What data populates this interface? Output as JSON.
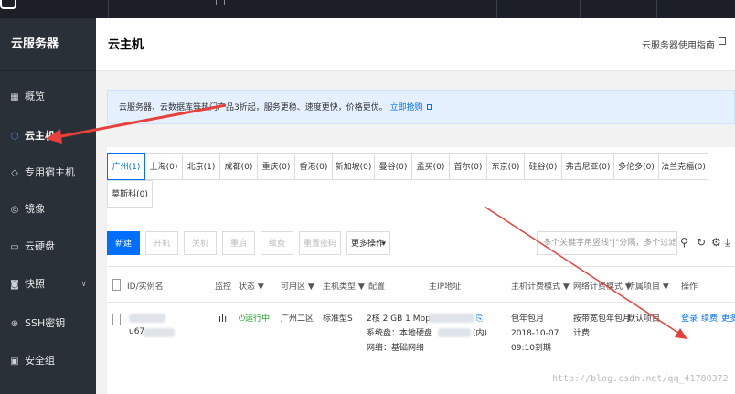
{
  "sidebar": {
    "title": "云服务器",
    "items": [
      {
        "label": "概览",
        "icon": "grid-icon"
      },
      {
        "label": "云主机",
        "icon": "cube-icon",
        "active": true
      },
      {
        "label": "专用宿主机",
        "icon": "diamond-icon"
      },
      {
        "label": "镜像",
        "icon": "disc-icon"
      },
      {
        "label": "云硬盘",
        "icon": "disk-icon"
      },
      {
        "label": "快照",
        "icon": "camera-icon",
        "has_chevron": true
      },
      {
        "label": "SSH密钥",
        "icon": "key-icon"
      },
      {
        "label": "安全组",
        "icon": "shield-icon"
      }
    ]
  },
  "header": {
    "title": "云主机",
    "guide_link": "云服务器使用指南"
  },
  "notice": {
    "text": "云服务器、云数据库等热门产品3折起，服务更稳、速度更快，价格更优。",
    "link": "立即抢购"
  },
  "regions": {
    "row1": [
      "广州(1)",
      "上海(0)",
      "北京(1)",
      "成都(0)",
      "重庆(0)",
      "香港(0)",
      "新加坡(0)",
      "曼谷(0)",
      "孟买(0)",
      "首尔(0)",
      "东京(0)",
      "硅谷(0)",
      "弗吉尼亚(0)",
      "多伦多(0)",
      "法兰克福(0)"
    ],
    "row2": [
      "莫斯科(0)"
    ]
  },
  "toolbar": {
    "buttons": [
      "新建",
      "开机",
      "关机",
      "重启",
      "续费",
      "重置密码",
      "更多操作"
    ],
    "search_placeholder": "多个关键字用竖线\"|\"分隔，多个过滤标签用回车键分隔"
  },
  "table": {
    "headers": [
      "ID/实例名",
      "监控",
      "状态",
      "可用区",
      "主机类型",
      "配置",
      "主IP地址",
      "主机计费模式",
      "网络计费模式",
      "所属项目",
      "操作"
    ],
    "row": {
      "id_fragment": "u67",
      "status": "运行中",
      "zone": "广州二区",
      "type": "标准型S",
      "config_line1": "2核 2 GB 1 Mbps",
      "config_line2": "系统盘：本地硬盘",
      "config_line3": "网络：基础网络",
      "ip_suffix": "(内)",
      "billing_line1": "包年包月",
      "billing_line2": "2018-10-07",
      "billing_line3": "09:10到期",
      "net_billing_line1": "按带宽包年包月",
      "net_billing_line2": "计费",
      "project": "默认项目",
      "op_login": "登录",
      "op_renew": "续费",
      "op_more": "更多"
    }
  },
  "watermark": "http://blog.csdn.net/qq_41780372",
  "colors": {
    "accent": "#006eff",
    "sidebar_bg": "#293038",
    "arrow": "#e8403a"
  }
}
